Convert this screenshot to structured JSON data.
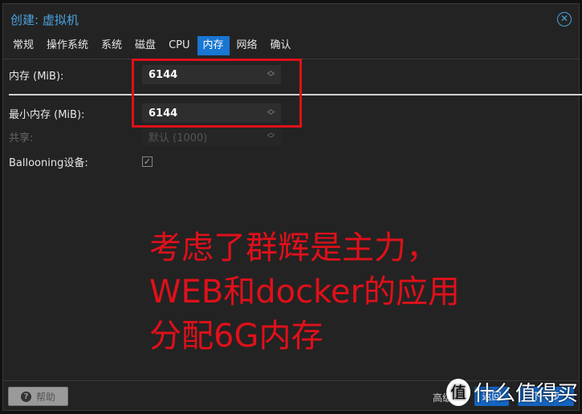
{
  "dialog": {
    "title": "创建: 虚拟机",
    "close_icon": "close-circle-icon"
  },
  "tabs": [
    {
      "label": "常规"
    },
    {
      "label": "操作系统"
    },
    {
      "label": "系统"
    },
    {
      "label": "磁盘"
    },
    {
      "label": "CPU"
    },
    {
      "label": "内存",
      "active": true
    },
    {
      "label": "网络"
    },
    {
      "label": "确认"
    }
  ],
  "form": {
    "memory": {
      "label": "内存 (MiB):",
      "value": "6144"
    },
    "min_memory": {
      "label": "最小内存 (MiB):",
      "value": "6144"
    },
    "shares": {
      "label": "共享:",
      "placeholder": "默认 (1000)"
    },
    "ballooning": {
      "label": "Ballooning设备:",
      "checked": true
    }
  },
  "annotation": {
    "lines": [
      "考虑了群辉是主力，",
      "WEB和docker的应用",
      "分配6G内存"
    ],
    "color": "#e0101a"
  },
  "footer": {
    "help": "帮助",
    "advanced": "高级",
    "back": "返回",
    "next": "下一步"
  },
  "watermark": {
    "badge": "值",
    "text": "什么值得买"
  },
  "colors": {
    "accent": "#1976d2",
    "title": "#4aa3df"
  }
}
